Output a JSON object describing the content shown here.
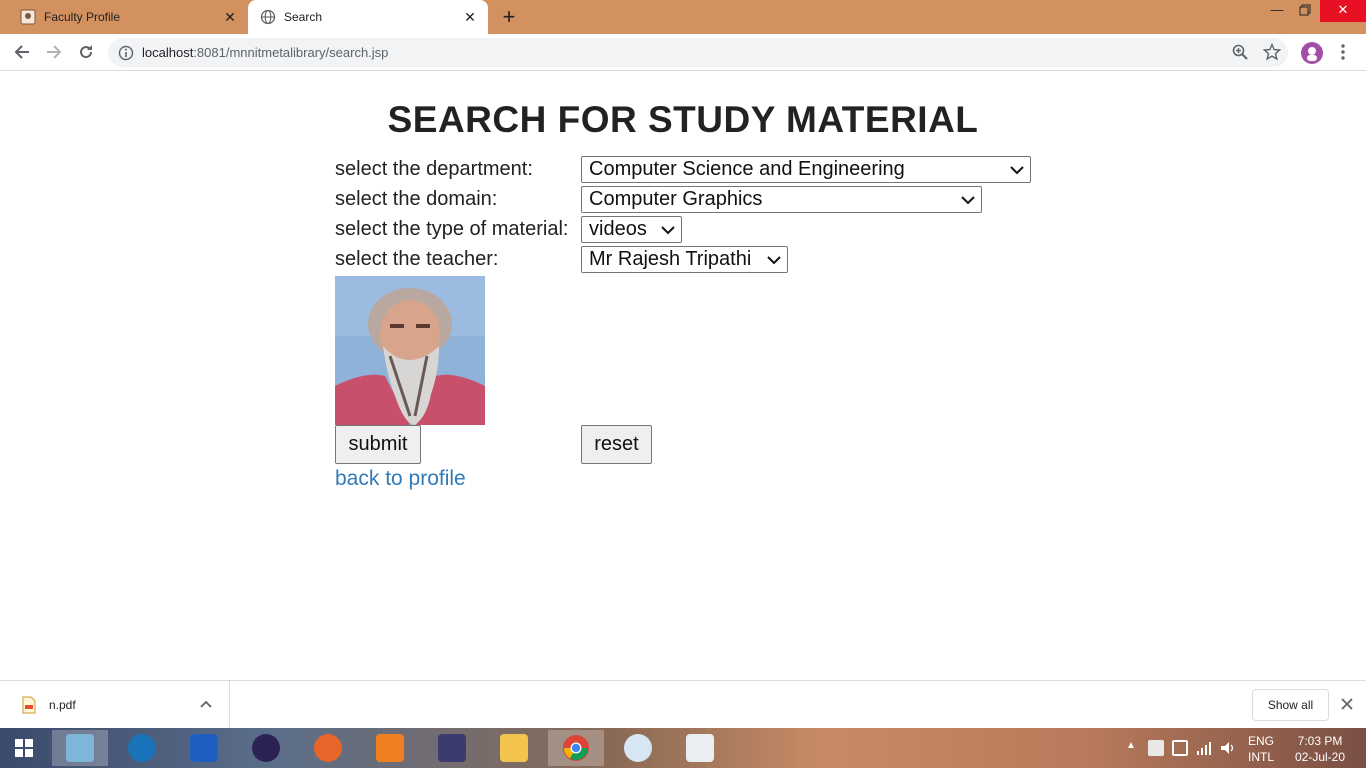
{
  "browser": {
    "tabs": [
      {
        "title": "Faculty Profile",
        "active": false
      },
      {
        "title": "Search",
        "active": true
      }
    ],
    "url_host": "localhost",
    "url_path": ":8081/mnnitmetalibrary/search.jsp"
  },
  "page": {
    "title": "SEARCH FOR STUDY MATERIAL",
    "fields": {
      "department": {
        "label": "select the department:",
        "value": "Computer Science and Engineering"
      },
      "domain": {
        "label": "select the domain:",
        "value": "Computer Graphics"
      },
      "material": {
        "label": "select the type of material:",
        "value": "videos"
      },
      "teacher": {
        "label": "select the teacher:",
        "value": "Mr Rajesh Tripathi"
      }
    },
    "submit_label": "submit",
    "reset_label": "reset",
    "back_link": "back to profile"
  },
  "downloads": {
    "file_name": "n.pdf",
    "show_all": "Show all"
  },
  "taskbar": {
    "lang_top": "ENG",
    "lang_bottom": "INTL",
    "time": "7:03 PM",
    "date": "02-Jul-20"
  }
}
